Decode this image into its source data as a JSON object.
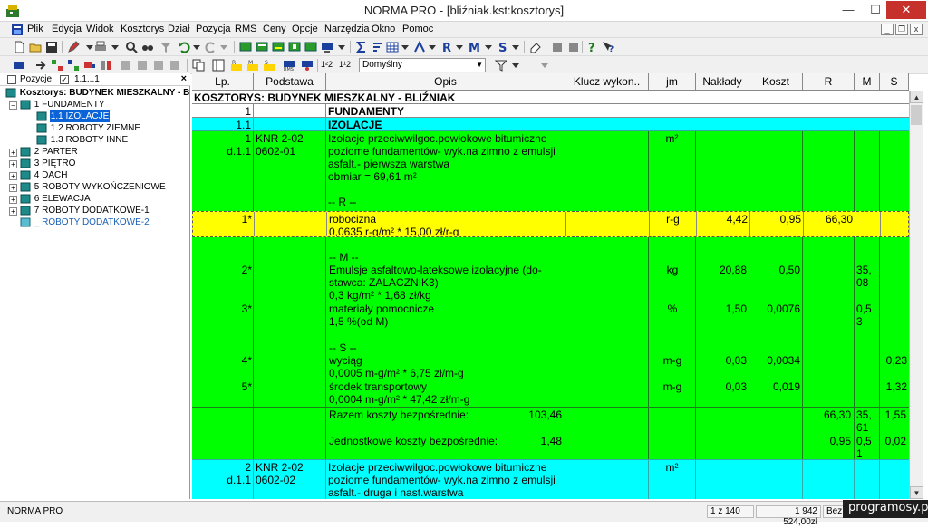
{
  "window": {
    "title": "NORMA PRO - [bliźniak.kst:kosztorys]",
    "minimize": "—",
    "maximize": "☐",
    "close": "✕"
  },
  "menu": [
    "Plik",
    "Edycja",
    "Widok",
    "Kosztorys",
    "Dział",
    "Pozycja",
    "RMS",
    "Ceny",
    "Opcje",
    "Narzędzia",
    "Okno",
    "Pomoc"
  ],
  "mdi": {
    "minimize": "_",
    "restore": "❐",
    "close": "x"
  },
  "toolbar2": {
    "buttons": [
      "1²2",
      "1¹2"
    ],
    "dropdown_value": "Domyślny"
  },
  "left_panel": {
    "filter_pozycje": "Pozycje",
    "filter_value": "1.1...1",
    "close": "×",
    "tree": [
      {
        "label": "Kosztorys: BUDYNEK  MIESZKALNY - B",
        "level": 0,
        "bold": true
      },
      {
        "label": "1 FUNDAMENTY",
        "level": 1
      },
      {
        "label": "1.1 IZOLACJE",
        "level": 2,
        "selected": true
      },
      {
        "label": "1.2 ROBOTY ZIEMNE",
        "level": 2
      },
      {
        "label": "1.3 ROBOTY INNE",
        "level": 2
      },
      {
        "label": "2 PARTER",
        "level": 1
      },
      {
        "label": "3 PIĘTRO",
        "level": 1
      },
      {
        "label": "4 DACH",
        "level": 1
      },
      {
        "label": "5 ROBOTY  WYKOŃCZENIOWE",
        "level": 1
      },
      {
        "label": "6 ELEWACJA",
        "level": 1
      },
      {
        "label": "7 ROBOTY DODATKOWE-1",
        "level": 1
      },
      {
        "label": "_ ROBOTY DODATKOWE-2",
        "level": 1,
        "dim": true
      }
    ]
  },
  "grid": {
    "headers": [
      "Lp.",
      "Podstawa",
      "Opis",
      "Klucz wykon..",
      "jm",
      "Nakłady",
      "Koszt jedn.",
      "R",
      "M",
      "S"
    ],
    "rows": {
      "kosztorys": "KOSZTORYS: BUDYNEK  MIESZKALNY - BLIŹNIAK",
      "dzial_lp": "1",
      "dzial_name": "FUNDAMENTY",
      "poddzial_lp": "1.1",
      "poddzial_name": "IZOLACJE",
      "pos1": {
        "lp1": "1",
        "lp2": "d.1.1",
        "podstawa1": "KNR 2-02",
        "podstawa2": "0602-01",
        "opis": [
          "Izolacje przeciwwilgoc.powłokowe bitumiczne",
          "poziome fundamentów- wyk.na zimno z emulsji",
          "asfalt.- pierwsza warstwa",
          "obmiar  = 69,61 m²"
        ],
        "jm": "m²",
        "r_header": "-- R --"
      },
      "r1": {
        "lp": "1*",
        "opis1": "robocizna",
        "opis2": "0,0635 r-g/m² * 15,00 zł/r-g",
        "jm": "r-g",
        "naklady": "4,42",
        "koszt": "0,95",
        "r": "66,30"
      },
      "m_header": "-- M --",
      "m2": {
        "lp": "2*",
        "opis": [
          "Emulsje asfaltowo-lateksowe izolacyjne (do-",
          "stawca: ZALACZNIK3)",
          "0,3 kg/m² * 1,68 zł/kg"
        ],
        "jm": "kg",
        "naklady": "20,88",
        "koszt": "0,50",
        "m": [
          "35,",
          "08"
        ]
      },
      "m3": {
        "lp": "3*",
        "opis": [
          "materiały pomocnicze",
          "1,5 %(od M)"
        ],
        "jm": "%",
        "naklady": "1,50",
        "koszt": "0,0076",
        "m": [
          "0,5",
          "3"
        ]
      },
      "s_header": "-- S --",
      "s4": {
        "lp": "4*",
        "opis": [
          "wyciąg",
          "0,0005 m-g/m² * 6,75 zł/m-g"
        ],
        "jm": "m-g",
        "naklady": "0,03",
        "koszt": "0,0034",
        "s": "0,23"
      },
      "s5": {
        "lp": "5*",
        "opis": [
          "środek transportowy",
          "0,0004 m-g/m² * 47,42 zł/m-g"
        ],
        "jm": "m-g",
        "naklady": "0,03",
        "koszt": "0,019",
        "s": "1,32"
      },
      "sum": {
        "razem_label": "Razem koszty bezpośrednie:",
        "razem_value": "103,46",
        "jedn_label": "Jednostkowe koszty bezpośrednie:",
        "jedn_value": "1,48",
        "razem_r": "66,30",
        "razem_m": [
          "35,",
          "61"
        ],
        "razem_s": "1,55",
        "jedn_r": "0,95",
        "jedn_m": [
          "0,5",
          "1"
        ],
        "jedn_s": "0,02"
      },
      "pos2": {
        "lp1": "2",
        "lp2": "d.1.1",
        "podstawa1": "KNR 2-02",
        "podstawa2": "0602-02",
        "opis": [
          "Izolacje przeciwwilgoc.powłokowe bitumiczne",
          "poziome fundamentów- wyk.na zimno z emulsji",
          "asfalt.- druga i nast.warstwa"
        ],
        "jm": "m²"
      }
    }
  },
  "status": {
    "app": "NORMA PRO",
    "page": "1 z 140",
    "total": "1 942 524,00zł",
    "mode": "Bez"
  },
  "watermark": "programosy.pl",
  "colors": {
    "position_row": "#00ff00",
    "section_row": "#00ffff",
    "selected_row": "#ffff00",
    "selection_highlight": "#0a64d8"
  }
}
